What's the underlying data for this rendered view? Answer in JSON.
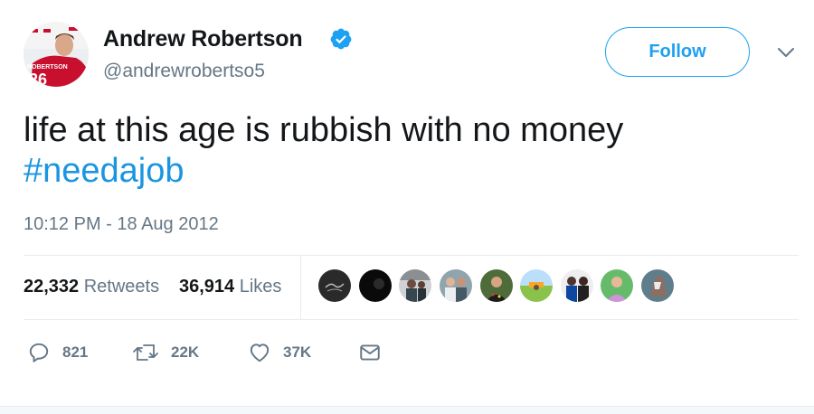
{
  "author": {
    "name": "Andrew Robertson",
    "handle": "@andrewrobertso5",
    "avatar_icon": "profile-photo",
    "verified": true
  },
  "follow_button": {
    "label": "Follow"
  },
  "tweet": {
    "text": "life at this age is rubbish with no money",
    "hashtag": "#needajob",
    "timestamp": "10:12 PM - 18 Aug 2012"
  },
  "stats": {
    "retweets_count": "22,332",
    "retweets_label": "Retweets",
    "likes_count": "36,914",
    "likes_label": "Likes"
  },
  "liker_avatars": [
    {
      "icon": "liker-avatar-1"
    },
    {
      "icon": "liker-avatar-2"
    },
    {
      "icon": "liker-avatar-3"
    },
    {
      "icon": "liker-avatar-4"
    },
    {
      "icon": "liker-avatar-5"
    },
    {
      "icon": "liker-avatar-6"
    },
    {
      "icon": "liker-avatar-7"
    },
    {
      "icon": "liker-avatar-8"
    },
    {
      "icon": "liker-avatar-9"
    }
  ],
  "actions": {
    "reply_count": "821",
    "retweet_count": "22K",
    "like_count": "37K"
  },
  "colors": {
    "accent": "#1da1f2",
    "hashtag": "#1b95e0",
    "muted": "#657786",
    "text": "#14171a"
  }
}
